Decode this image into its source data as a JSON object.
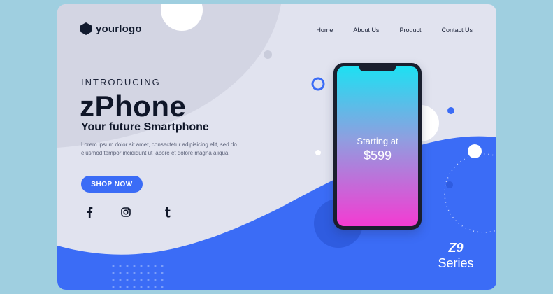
{
  "brand": {
    "logo_text": "yourlogo"
  },
  "nav": {
    "items": [
      "Home",
      "About Us",
      "Product",
      "Contact Us"
    ]
  },
  "hero": {
    "intro": "INTRODUCING",
    "title": "zPhone",
    "subtitle": "Your future Smartphone",
    "description": "Lorem ipsum dolor sit amet, consectetur adipisicing elit, sed do eiusmod tempor incididunt ut labore et dolore magna aliqua.",
    "cta": "SHOP NOW"
  },
  "social": {
    "icons": [
      "facebook-icon",
      "instagram-icon",
      "tumblr-icon"
    ]
  },
  "phone": {
    "price_label": "Starting at",
    "price": "$599"
  },
  "series": {
    "code": "Z9",
    "label": "Series"
  },
  "colors": {
    "accent": "#3b6cf6",
    "background": "#9fcfe0",
    "card": "#e1e3ef",
    "dark": "#0f1628"
  }
}
